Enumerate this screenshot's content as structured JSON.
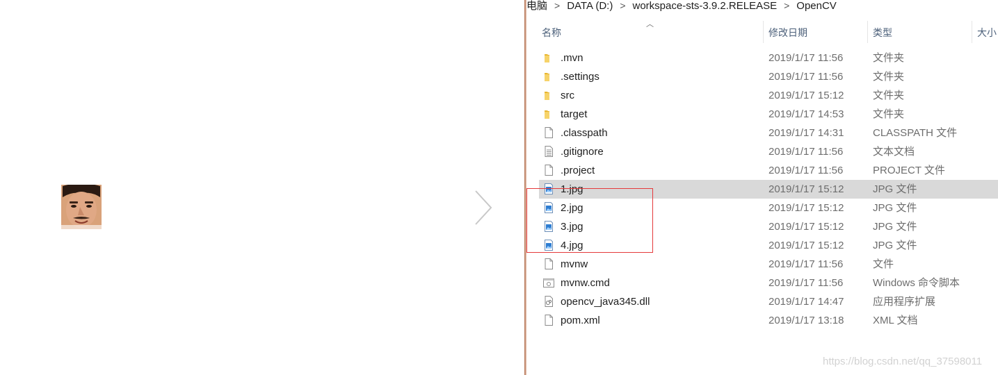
{
  "viewer": {
    "thumbnail": "face-thumbnail",
    "next_icon": "chevron-right-icon"
  },
  "breadcrumb": [
    "电脑",
    "DATA (D:)",
    "workspace-sts-3.9.2.RELEASE",
    "OpenCV"
  ],
  "columns": {
    "name": "名称",
    "date": "修改日期",
    "type": "类型",
    "size": "大小"
  },
  "files": [
    {
      "name": ".mvn",
      "date": "2019/1/17 11:56",
      "type": "文件夹",
      "icon": "folder-icon"
    },
    {
      "name": ".settings",
      "date": "2019/1/17 11:56",
      "type": "文件夹",
      "icon": "folder-icon"
    },
    {
      "name": "src",
      "date": "2019/1/17 15:12",
      "type": "文件夹",
      "icon": "folder-icon"
    },
    {
      "name": "target",
      "date": "2019/1/17 14:53",
      "type": "文件夹",
      "icon": "folder-icon"
    },
    {
      "name": ".classpath",
      "date": "2019/1/17 14:31",
      "type": "CLASSPATH 文件",
      "icon": "file-icon"
    },
    {
      "name": ".gitignore",
      "date": "2019/1/17 11:56",
      "type": "文本文档",
      "icon": "text-file-icon"
    },
    {
      "name": ".project",
      "date": "2019/1/17 11:56",
      "type": "PROJECT 文件",
      "icon": "file-icon"
    },
    {
      "name": "1.jpg",
      "date": "2019/1/17 15:12",
      "type": "JPG 文件",
      "icon": "image-file-icon",
      "selected": true
    },
    {
      "name": "2.jpg",
      "date": "2019/1/17 15:12",
      "type": "JPG 文件",
      "icon": "image-file-icon"
    },
    {
      "name": "3.jpg",
      "date": "2019/1/17 15:12",
      "type": "JPG 文件",
      "icon": "image-file-icon"
    },
    {
      "name": "4.jpg",
      "date": "2019/1/17 15:12",
      "type": "JPG 文件",
      "icon": "image-file-icon"
    },
    {
      "name": "mvnw",
      "date": "2019/1/17 11:56",
      "type": "文件",
      "icon": "file-icon"
    },
    {
      "name": "mvnw.cmd",
      "date": "2019/1/17 11:56",
      "type": "Windows 命令脚本",
      "icon": "script-file-icon"
    },
    {
      "name": "opencv_java345.dll",
      "date": "2019/1/17 14:47",
      "type": "应用程序扩展",
      "icon": "dll-file-icon"
    },
    {
      "name": "pom.xml",
      "date": "2019/1/17 13:18",
      "type": "XML 文档",
      "icon": "file-icon"
    }
  ],
  "colors": {
    "selected_row": "#d9d9d9",
    "highlight_box": "#e5393b",
    "folder": "#f4c542",
    "header_text": "#4c607a"
  },
  "watermark": "https://blog.csdn.net/qq_37598011"
}
